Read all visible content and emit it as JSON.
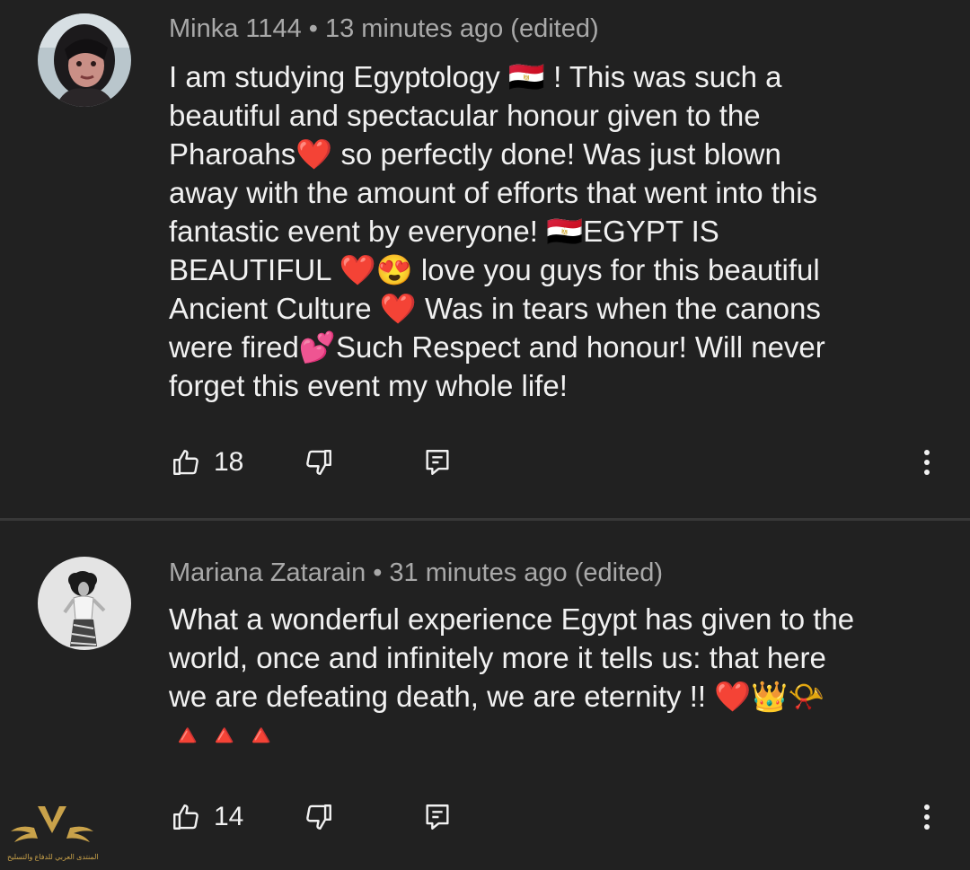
{
  "comments": [
    {
      "author": "Minka 1144",
      "separator": "•",
      "time": "13 minutes ago (edited)",
      "lines": [
        "I am studying Egyptology 🇪🇬 ! This was such a",
        "beautiful and spectacular honour given to the",
        "Pharoahs❤️ so perfectly done! Was just blown",
        "away with the amount of efforts that went into this",
        "fantastic event by everyone! 🇪🇬EGYPT IS",
        "BEAUTIFUL ❤️😍 love you guys for this beautiful",
        "Ancient Culture ❤️ Was in tears when the canons",
        "were fired💕Such Respect and honour! Will never",
        "forget this event my whole life!"
      ],
      "likes": "18"
    },
    {
      "author": "Mariana Zatarain",
      "separator": "•",
      "time": "31 minutes ago (edited)",
      "lines": [
        "What a wonderful experience Egypt has given to the",
        "world, once and infinitely more it tells us: that here",
        "we are defeating death, we are eternity !! ❤️👑📯",
        "🔺🔺🔺"
      ],
      "likes": "14"
    }
  ],
  "icons": {
    "like": "thumb-up-icon",
    "dislike": "thumb-down-icon",
    "reply": "reply-comment-icon",
    "more": "more-vert-icon"
  },
  "watermark": {
    "text": "المنتدى العربي للدفاع والتسليح"
  },
  "colors": {
    "background": "#212121",
    "text": "#f1f1f1",
    "meta": "#a9a9a9",
    "divider": "#383838",
    "watermark": "#c9a24a"
  }
}
